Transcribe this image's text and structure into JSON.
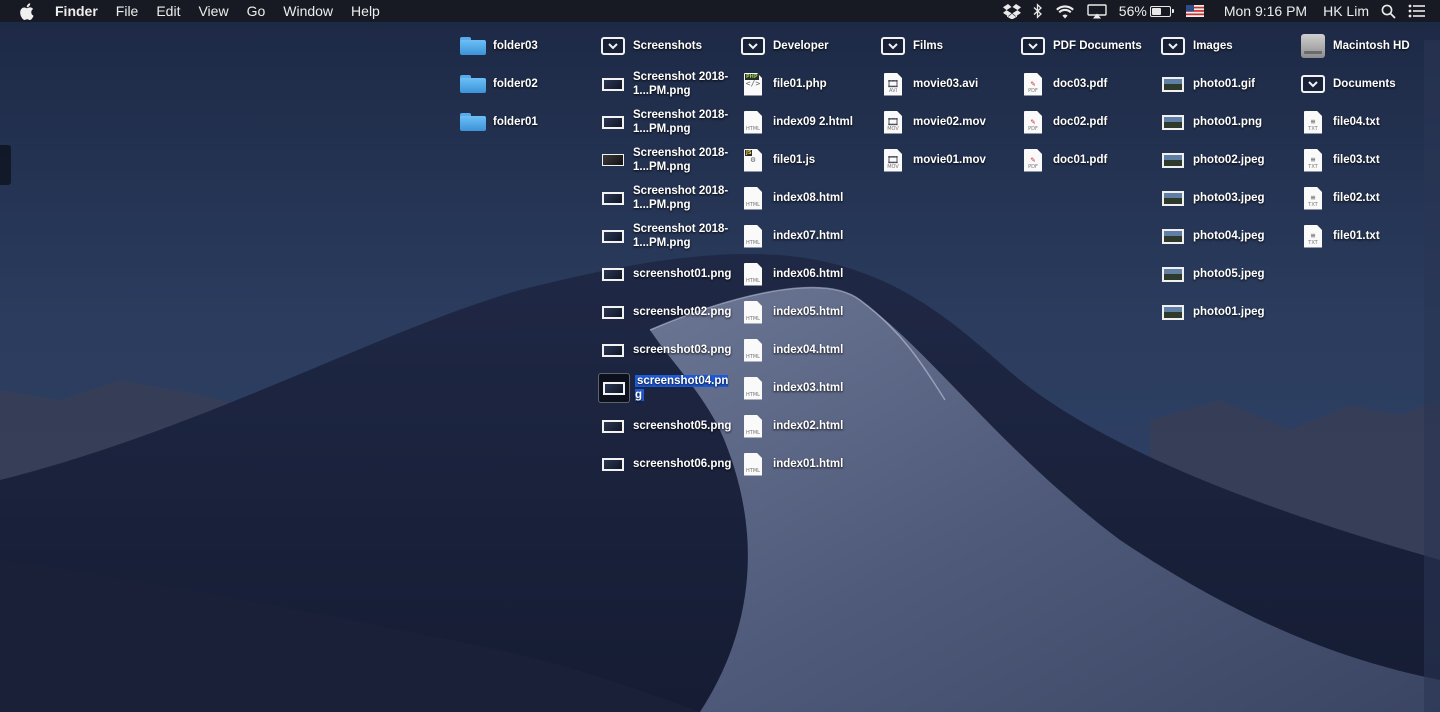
{
  "menubar": {
    "apple_icon": "apple-logo",
    "app_name": "Finder",
    "menus": [
      "File",
      "Edit",
      "View",
      "Go",
      "Window",
      "Help"
    ],
    "status": {
      "battery_percent": "56%",
      "battery_level": 0.56,
      "clock": "Mon 9:16 PM",
      "user": "HK Lim"
    }
  },
  "desktop": {
    "selection_color": "#1f5bd8",
    "columns": [
      {
        "items": [
          {
            "label": "folder03",
            "kind": "folder"
          },
          {
            "label": "folder02",
            "kind": "folder"
          },
          {
            "label": "folder01",
            "kind": "folder"
          }
        ]
      },
      {
        "items": [
          {
            "label": "Screenshots",
            "kind": "stack"
          },
          {
            "label": "Screenshot 2018-1...PM.png",
            "kind": "screenshot"
          },
          {
            "label": "Screenshot 2018-1...PM.png",
            "kind": "screenshot"
          },
          {
            "label": "Screenshot 2018-1...PM.png",
            "kind": "screenshot-small"
          },
          {
            "label": "Screenshot 2018-1...PM.png",
            "kind": "screenshot"
          },
          {
            "label": "Screenshot 2018-1...PM.png",
            "kind": "screenshot"
          },
          {
            "label": "screenshot01.png",
            "kind": "screenshot"
          },
          {
            "label": "screenshot02.png",
            "kind": "screenshot"
          },
          {
            "label": "screenshot03.png",
            "kind": "screenshot"
          },
          {
            "label": "screenshot04.png",
            "kind": "screenshot",
            "selected": true
          },
          {
            "label": "screenshot05.png",
            "kind": "screenshot"
          },
          {
            "label": "screenshot06.png",
            "kind": "screenshot"
          }
        ]
      },
      {
        "items": [
          {
            "label": "Developer",
            "kind": "stack"
          },
          {
            "label": "file01.php",
            "kind": "php"
          },
          {
            "label": "index09 2.html",
            "kind": "html"
          },
          {
            "label": "file01.js",
            "kind": "js"
          },
          {
            "label": "index08.html",
            "kind": "html"
          },
          {
            "label": "index07.html",
            "kind": "html"
          },
          {
            "label": "index06.html",
            "kind": "html"
          },
          {
            "label": "index05.html",
            "kind": "html"
          },
          {
            "label": "index04.html",
            "kind": "html"
          },
          {
            "label": "index03.html",
            "kind": "html"
          },
          {
            "label": "index02.html",
            "kind": "html"
          },
          {
            "label": "index01.html",
            "kind": "html"
          }
        ]
      },
      {
        "items": [
          {
            "label": "Films",
            "kind": "stack"
          },
          {
            "label": "movie03.avi",
            "kind": "avi"
          },
          {
            "label": "movie02.mov",
            "kind": "mov"
          },
          {
            "label": "movie01.mov",
            "kind": "mov"
          }
        ]
      },
      {
        "items": [
          {
            "label": "PDF Documents",
            "kind": "stack"
          },
          {
            "label": "doc03.pdf",
            "kind": "pdf"
          },
          {
            "label": "doc02.pdf",
            "kind": "pdf"
          },
          {
            "label": "doc01.pdf",
            "kind": "pdf"
          }
        ]
      },
      {
        "items": [
          {
            "label": "Images",
            "kind": "stack"
          },
          {
            "label": "photo01.gif",
            "kind": "photo"
          },
          {
            "label": "photo01.png",
            "kind": "photo"
          },
          {
            "label": "photo02.jpeg",
            "kind": "photo"
          },
          {
            "label": "photo03.jpeg",
            "kind": "photo"
          },
          {
            "label": "photo04.jpeg",
            "kind": "photo"
          },
          {
            "label": "photo05.jpeg",
            "kind": "photo"
          },
          {
            "label": "photo01.jpeg",
            "kind": "photo"
          }
        ]
      },
      {
        "items": [
          {
            "label": "Macintosh HD",
            "kind": "drive"
          },
          {
            "label": "Documents",
            "kind": "stack"
          },
          {
            "label": "file04.txt",
            "kind": "txt"
          },
          {
            "label": "file03.txt",
            "kind": "txt"
          },
          {
            "label": "file02.txt",
            "kind": "txt"
          },
          {
            "label": "file01.txt",
            "kind": "txt"
          }
        ]
      }
    ]
  }
}
